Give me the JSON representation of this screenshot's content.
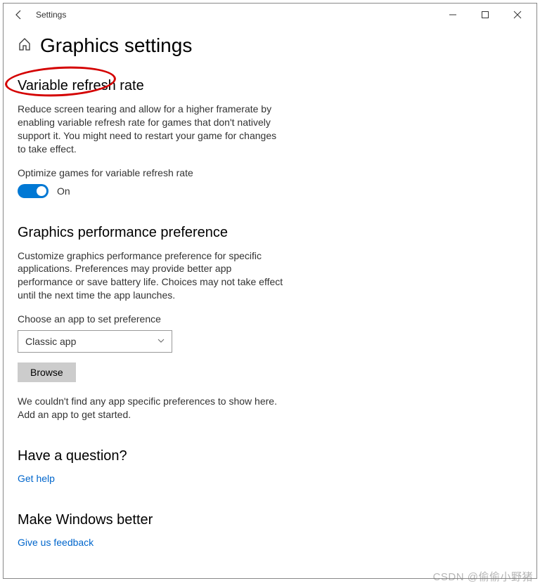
{
  "titlebar": {
    "title": "Settings"
  },
  "page": {
    "title": "Graphics settings"
  },
  "vrr": {
    "heading": "Variable refresh rate",
    "description": "Reduce screen tearing and allow for a higher framerate by enabling variable refresh rate for games that don't natively support it. You might need to restart your game for changes to take effect.",
    "optimize_label": "Optimize games for variable refresh rate",
    "toggle_state": "On"
  },
  "perf": {
    "heading": "Graphics performance preference",
    "description": "Customize graphics performance preference for specific applications. Preferences may provide better app performance or save battery life. Choices may not take effect until the next time the app launches.",
    "choose_label": "Choose an app to set preference",
    "dropdown_value": "Classic app",
    "browse_label": "Browse",
    "empty_msg": "We couldn't find any app specific preferences to show here. Add an app to get started."
  },
  "help": {
    "heading": "Have a question?",
    "link": "Get help"
  },
  "feedback": {
    "heading": "Make Windows better",
    "link": "Give us feedback"
  },
  "watermark": "CSDN @偷偷小野猪"
}
